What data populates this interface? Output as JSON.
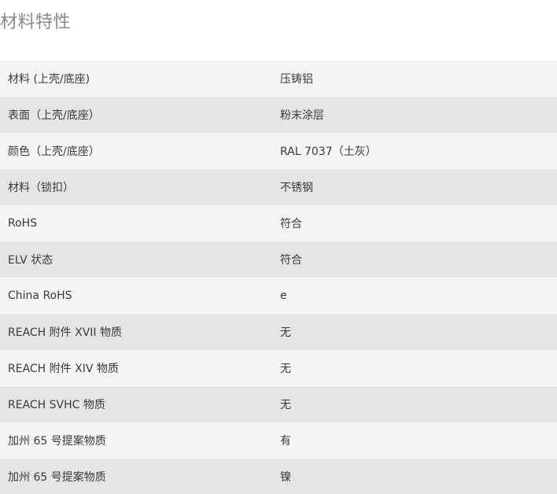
{
  "section": {
    "title": "材料特性"
  },
  "rows": [
    {
      "label": "材料 (上壳/底座)",
      "value": "压铸铝"
    },
    {
      "label": "表面（上壳/底座）",
      "value": "粉末涂层"
    },
    {
      "label": "颜色（上壳/底座）",
      "value": "RAL 7037（土灰）"
    },
    {
      "label": "材料（锁扣）",
      "value": "不锈钢"
    },
    {
      "label": "RoHS",
      "value": "符合"
    },
    {
      "label": "ELV 状态",
      "value": "符合"
    },
    {
      "label": "China RoHS",
      "value": "e"
    },
    {
      "label": "REACH 附件 XVII 物质",
      "value": "无"
    },
    {
      "label": "REACH 附件 XIV 物质",
      "value": "无"
    },
    {
      "label": "REACH SVHC 物质",
      "value": "无"
    },
    {
      "label": "加州 65 号提案物质",
      "value": "有"
    },
    {
      "label": "加州 65 号提案物质",
      "value": "镍"
    }
  ]
}
